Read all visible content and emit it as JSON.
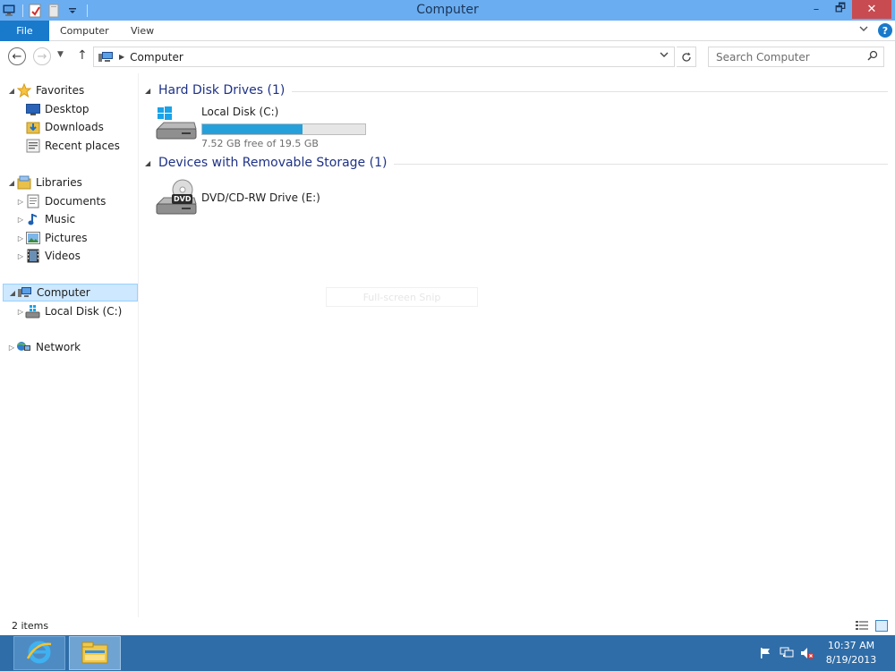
{
  "window": {
    "title": "Computer",
    "minimize_glyph": "–",
    "maximize_glyph": "🗗",
    "close_glyph": "✕"
  },
  "ribbon": {
    "file_tab": "File",
    "tabs": [
      "Computer",
      "View"
    ]
  },
  "address": {
    "path": "Computer",
    "search_placeholder": "Search Computer"
  },
  "nav_pane": {
    "favorites": {
      "label": "Favorites",
      "items": [
        "Desktop",
        "Downloads",
        "Recent places"
      ]
    },
    "libraries": {
      "label": "Libraries",
      "items": [
        "Documents",
        "Music",
        "Pictures",
        "Videos"
      ]
    },
    "computer": {
      "label": "Computer",
      "items": [
        "Local Disk (C:)"
      ]
    },
    "network": {
      "label": "Network"
    }
  },
  "content": {
    "groups": [
      {
        "title": "Hard Disk Drives (1)",
        "drives": [
          {
            "name": "Local Disk (C:)",
            "free_text": "7.52 GB free of 19.5 GB",
            "used_fraction": 0.614
          }
        ]
      },
      {
        "title": "Devices with Removable Storage (1)",
        "drives": [
          {
            "name": "DVD/CD-RW Drive (E:)",
            "badge": "DVD"
          }
        ]
      }
    ],
    "overlay_text": "Full-screen Snip"
  },
  "status": {
    "item_count": "2 items"
  },
  "taskbar": {
    "time": "10:37 AM",
    "date": "8/19/2013"
  },
  "colors": {
    "titlebar": "#6aaef1",
    "file_tab": "#1979ca",
    "selection": "#cde8ff",
    "progress_fill": "#26a0da",
    "group_title": "#1e3287",
    "taskbar": "#2f6da8"
  }
}
